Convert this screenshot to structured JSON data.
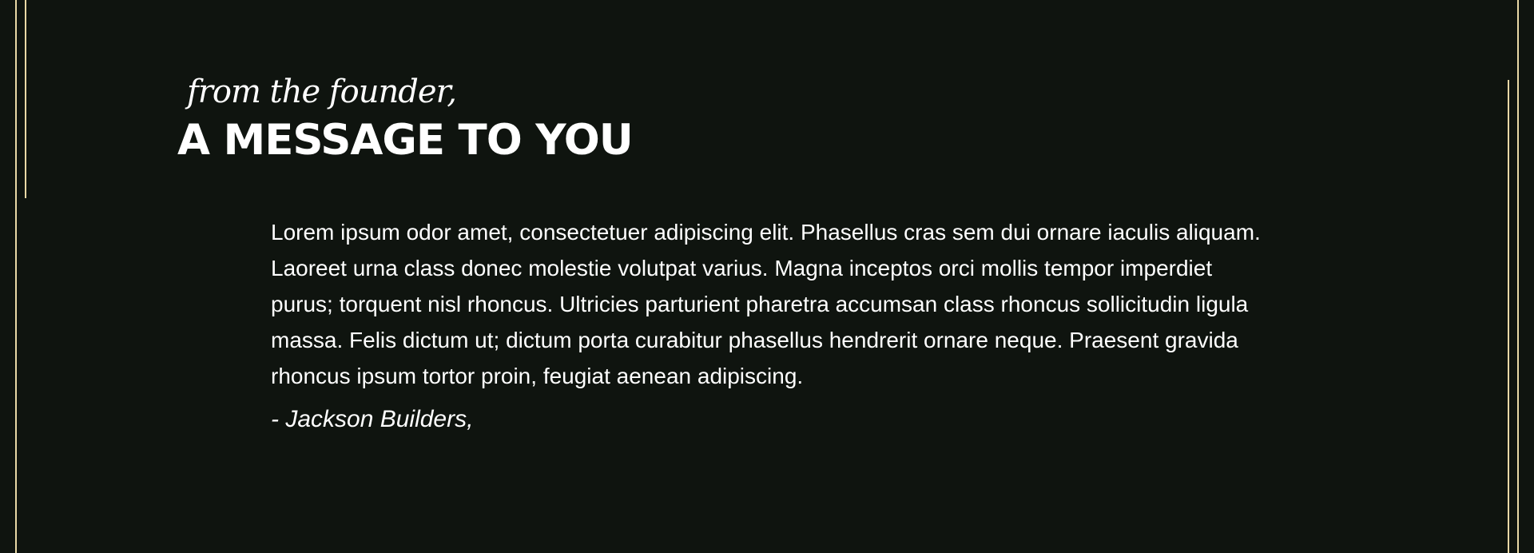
{
  "section": {
    "eyebrow": "from the founder,",
    "heading": "A MESSAGE TO YOU",
    "body": "Lorem ipsum odor amet, consectetuer adipiscing elit. Phasellus cras sem dui ornare iaculis aliquam. Laoreet urna class donec molestie volutpat varius. Magna inceptos orci mollis tempor imperdiet purus; torquent nisl rhoncus. Ultricies parturient pharetra accumsan class rhoncus sollicitudin ligula massa. Felis dictum ut; dictum porta curabitur phasellus hendrerit ornare neque. Praesent gravida rhoncus ipsum tortor proin, feugiat aenean adipiscing.",
    "signature": "- Jackson Builders,"
  },
  "colors": {
    "background": "#0f140f",
    "frame_line": "#e9d9a6",
    "text": "#ffffff"
  }
}
